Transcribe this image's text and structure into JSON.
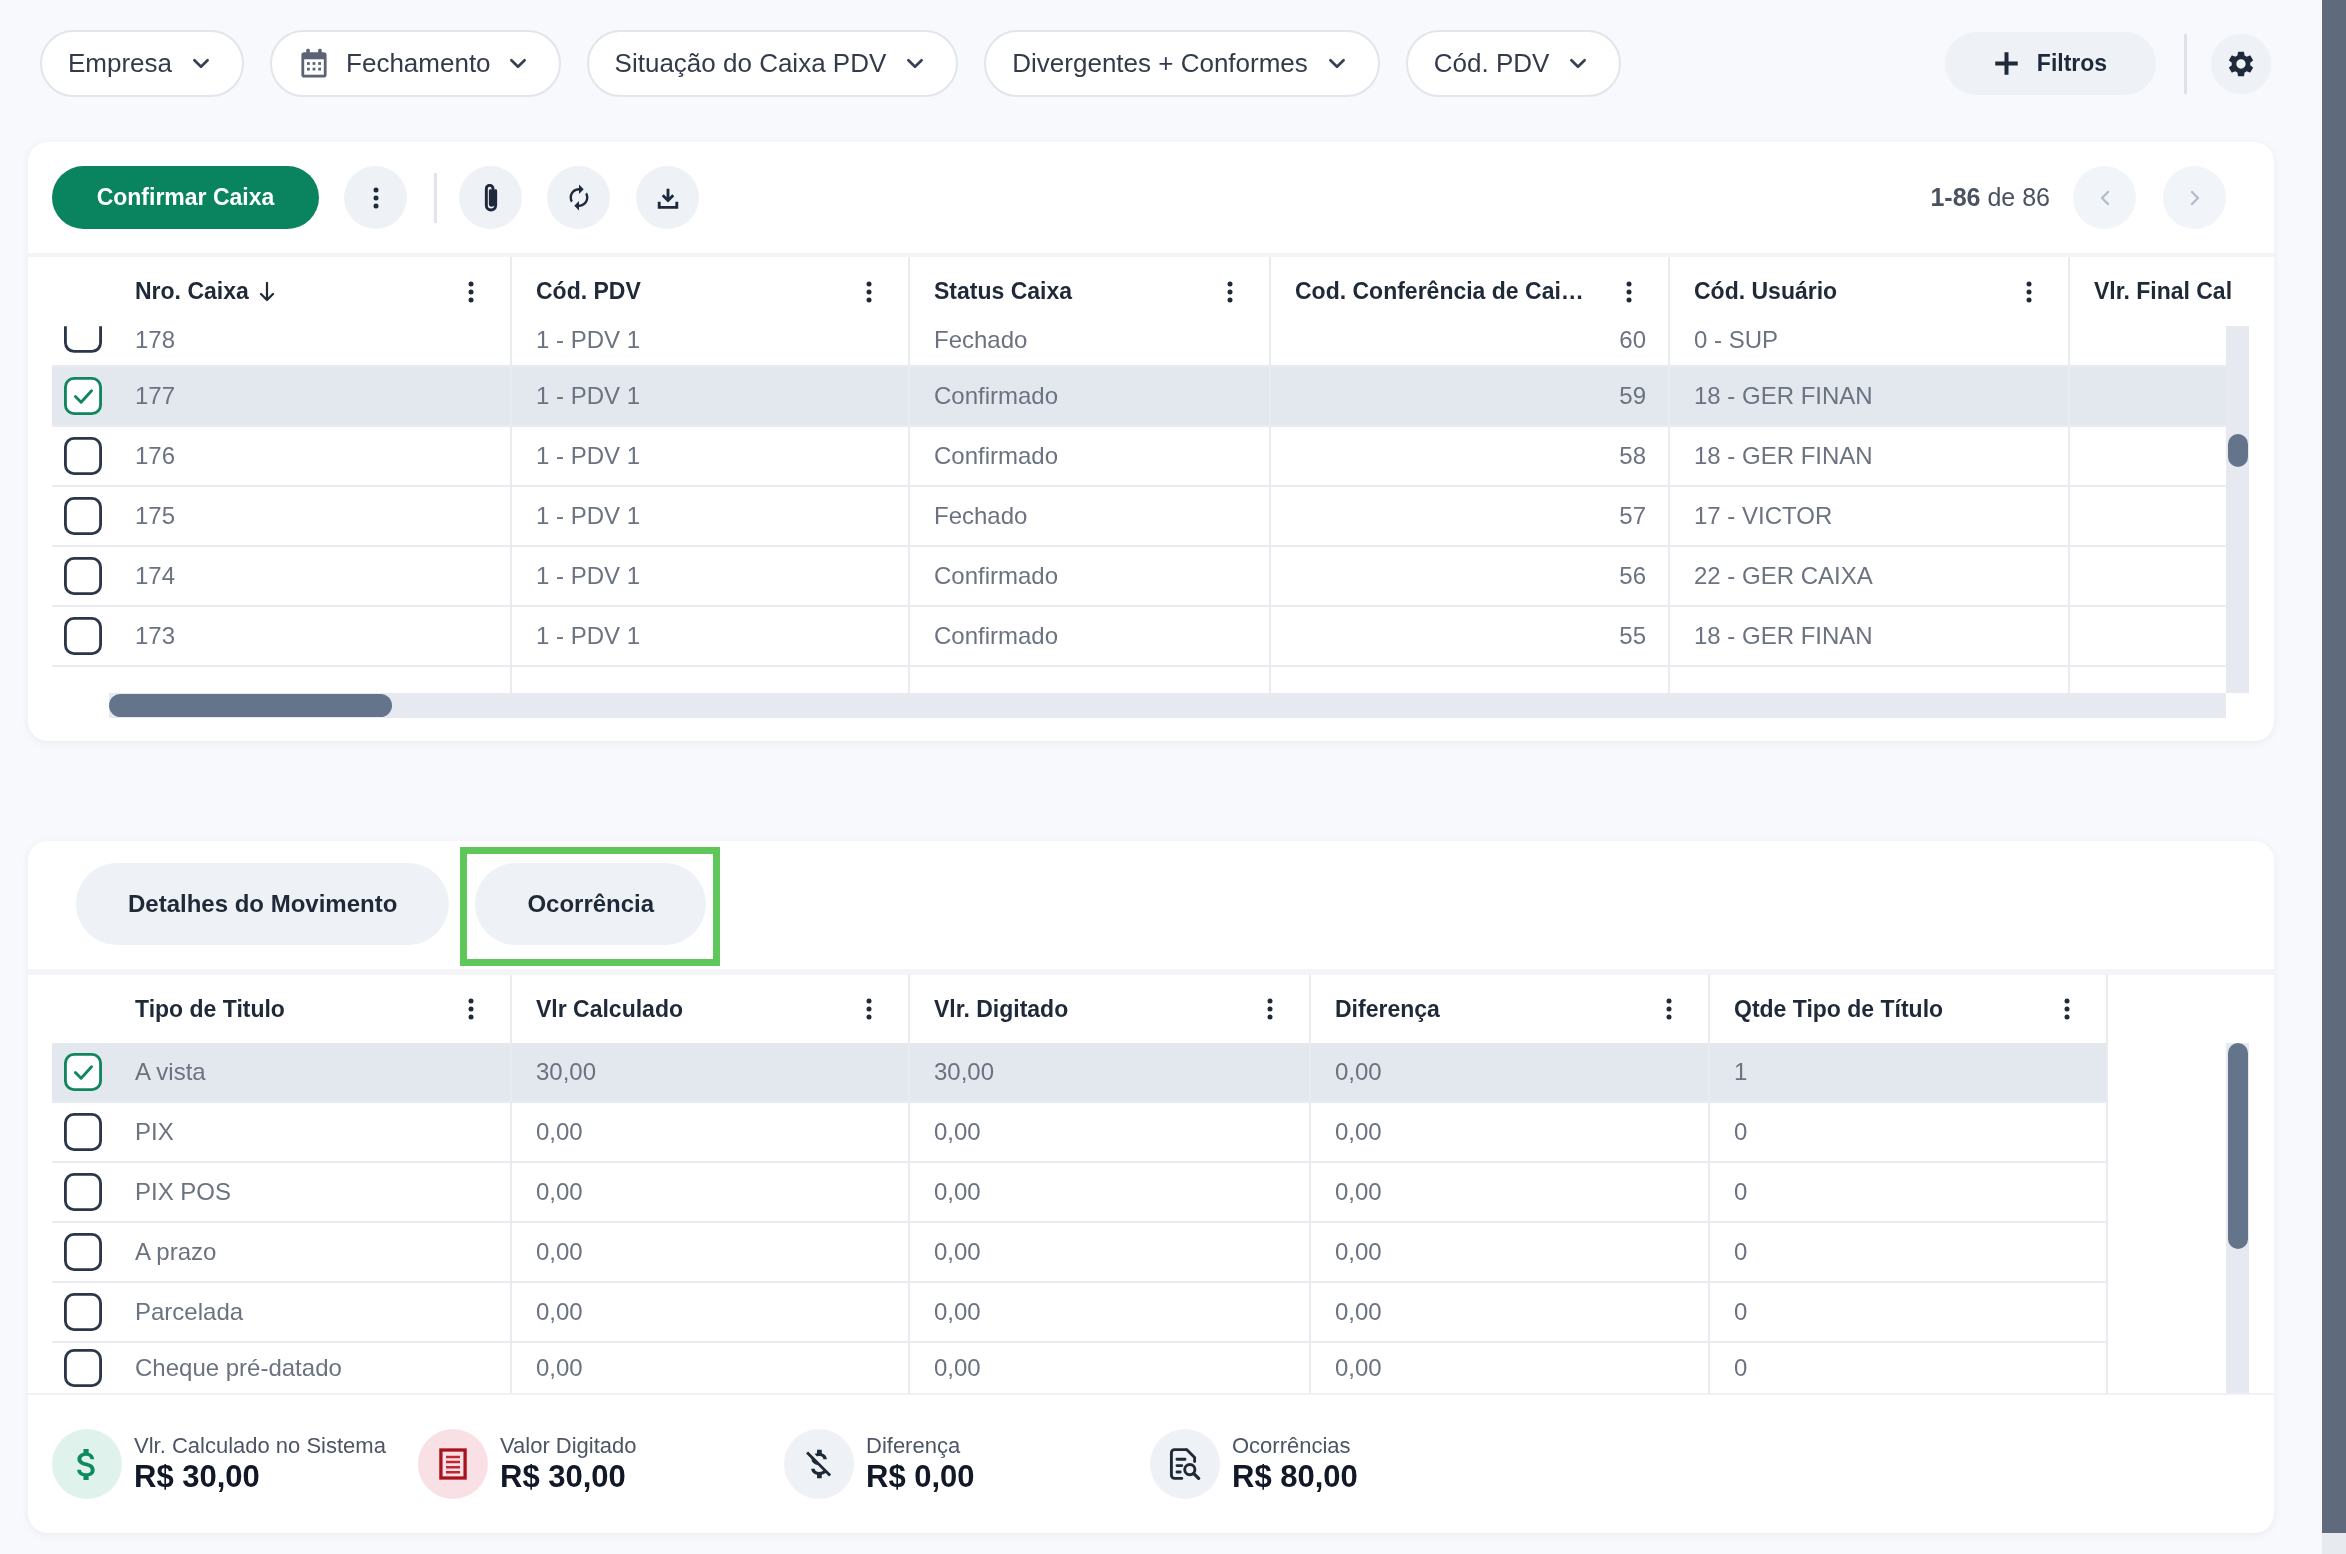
{
  "filter_bar": {
    "filters": [
      {
        "kind": "select",
        "label": "Empresa"
      },
      {
        "kind": "date",
        "label": "Fechamento"
      },
      {
        "kind": "select",
        "label": "Situação do Caixa PDV"
      },
      {
        "kind": "select",
        "label": "Divergentes + Conformes"
      },
      {
        "kind": "select",
        "label": "Cód. PDV"
      }
    ],
    "filters_button": "Filtros"
  },
  "cash_panel": {
    "toolbar": {
      "confirm_button": "Confirmar Caixa",
      "pagination": {
        "range": "**1-86** de 86",
        "previous_disabled": true,
        "next_disabled": true
      }
    },
    "table": {
      "columns": [
        {
          "label": "Nro. Caixa",
          "sorted": true
        },
        {
          "label": "Cód. PDV",
          "sorted": false
        },
        {
          "label": "Status Caixa",
          "sorted": false
        },
        {
          "label": "Cod. Conferência de Cai…",
          "sorted": false
        },
        {
          "label": "Cód. Usuário",
          "sorted": false
        },
        {
          "label": "Vlr. Final Cal",
          "sorted": false
        }
      ],
      "rows": [
        {
          "selected": false,
          "cells": [
            "178",
            "1 - PDV 1",
            "Fechado",
            "60",
            "0 - SUP"
          ]
        },
        {
          "selected": true,
          "cells": [
            "177",
            "1 - PDV 1",
            "Confirmado",
            "59",
            "18 - GER FINAN"
          ]
        },
        {
          "selected": false,
          "cells": [
            "176",
            "1 - PDV 1",
            "Confirmado",
            "58",
            "18 - GER FINAN"
          ]
        },
        {
          "selected": false,
          "cells": [
            "175",
            "1 - PDV 1",
            "Fechado",
            "57",
            "17 - VICTOR"
          ]
        },
        {
          "selected": false,
          "cells": [
            "174",
            "1 - PDV 1",
            "Confirmado",
            "56",
            "22 - GER CAIXA"
          ]
        },
        {
          "selected": false,
          "cells": [
            "173",
            "1 - PDV 1",
            "Confirmado",
            "55",
            "18 - GER FINAN"
          ]
        }
      ]
    }
  },
  "detail_panel": {
    "tabs": [
      {
        "label": "Detalhes do Movimento",
        "selected": false,
        "highlighted": false
      },
      {
        "label": "Ocorrência",
        "selected": false,
        "highlighted": true
      }
    ],
    "table": {
      "columns": [
        "Tipo de Titulo",
        "Vlr Calculado",
        "Vlr. Digitado",
        "Diferença",
        "Qtde Tipo de Título"
      ],
      "rows": [
        {
          "selected": true,
          "cells": [
            "A vista",
            "30,00",
            "30,00",
            "0,00",
            "1"
          ]
        },
        {
          "selected": false,
          "cells": [
            "PIX",
            "0,00",
            "0,00",
            "0,00",
            "0"
          ]
        },
        {
          "selected": false,
          "cells": [
            "PIX POS",
            "0,00",
            "0,00",
            "0,00",
            "0"
          ]
        },
        {
          "selected": false,
          "cells": [
            "A prazo",
            "0,00",
            "0,00",
            "0,00",
            "0"
          ]
        },
        {
          "selected": false,
          "cells": [
            "Parcelada",
            "0,00",
            "0,00",
            "0,00",
            "0"
          ]
        },
        {
          "selected": false,
          "cells": [
            "Cheque pré-datado",
            "0,00",
            "0,00",
            "0,00",
            "0"
          ]
        }
      ]
    },
    "summary": [
      {
        "label": "Vlr. Calculado no Sistema",
        "value": "R$ 30,00"
      },
      {
        "label": "Valor Digitado",
        "value": "R$ 30,00"
      },
      {
        "label": "Diferença",
        "value": "R$ 0,00"
      },
      {
        "label": "Ocorrências",
        "value": "R$ 80,00"
      }
    ]
  }
}
